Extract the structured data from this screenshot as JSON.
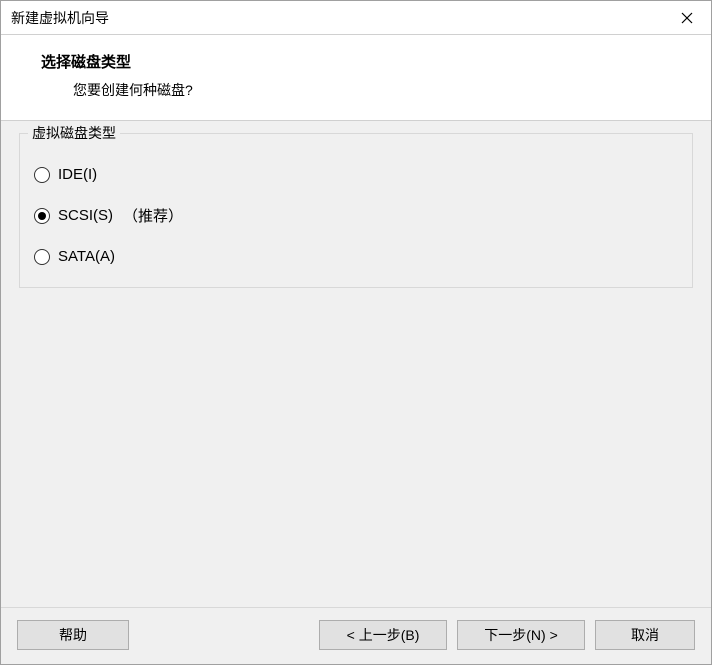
{
  "window": {
    "title": "新建虚拟机向导"
  },
  "header": {
    "title": "选择磁盘类型",
    "subtitle": "您要创建何种磁盘?"
  },
  "group": {
    "legend": "虚拟磁盘类型",
    "options": [
      {
        "label": "IDE(I)",
        "hint": "",
        "selected": false
      },
      {
        "label": "SCSI(S)",
        "hint": "（推荐）",
        "selected": true
      },
      {
        "label": "SATA(A)",
        "hint": "",
        "selected": false
      }
    ]
  },
  "footer": {
    "help": "帮助",
    "back": "< 上一步(B)",
    "next": "下一步(N) >",
    "cancel": "取消"
  }
}
